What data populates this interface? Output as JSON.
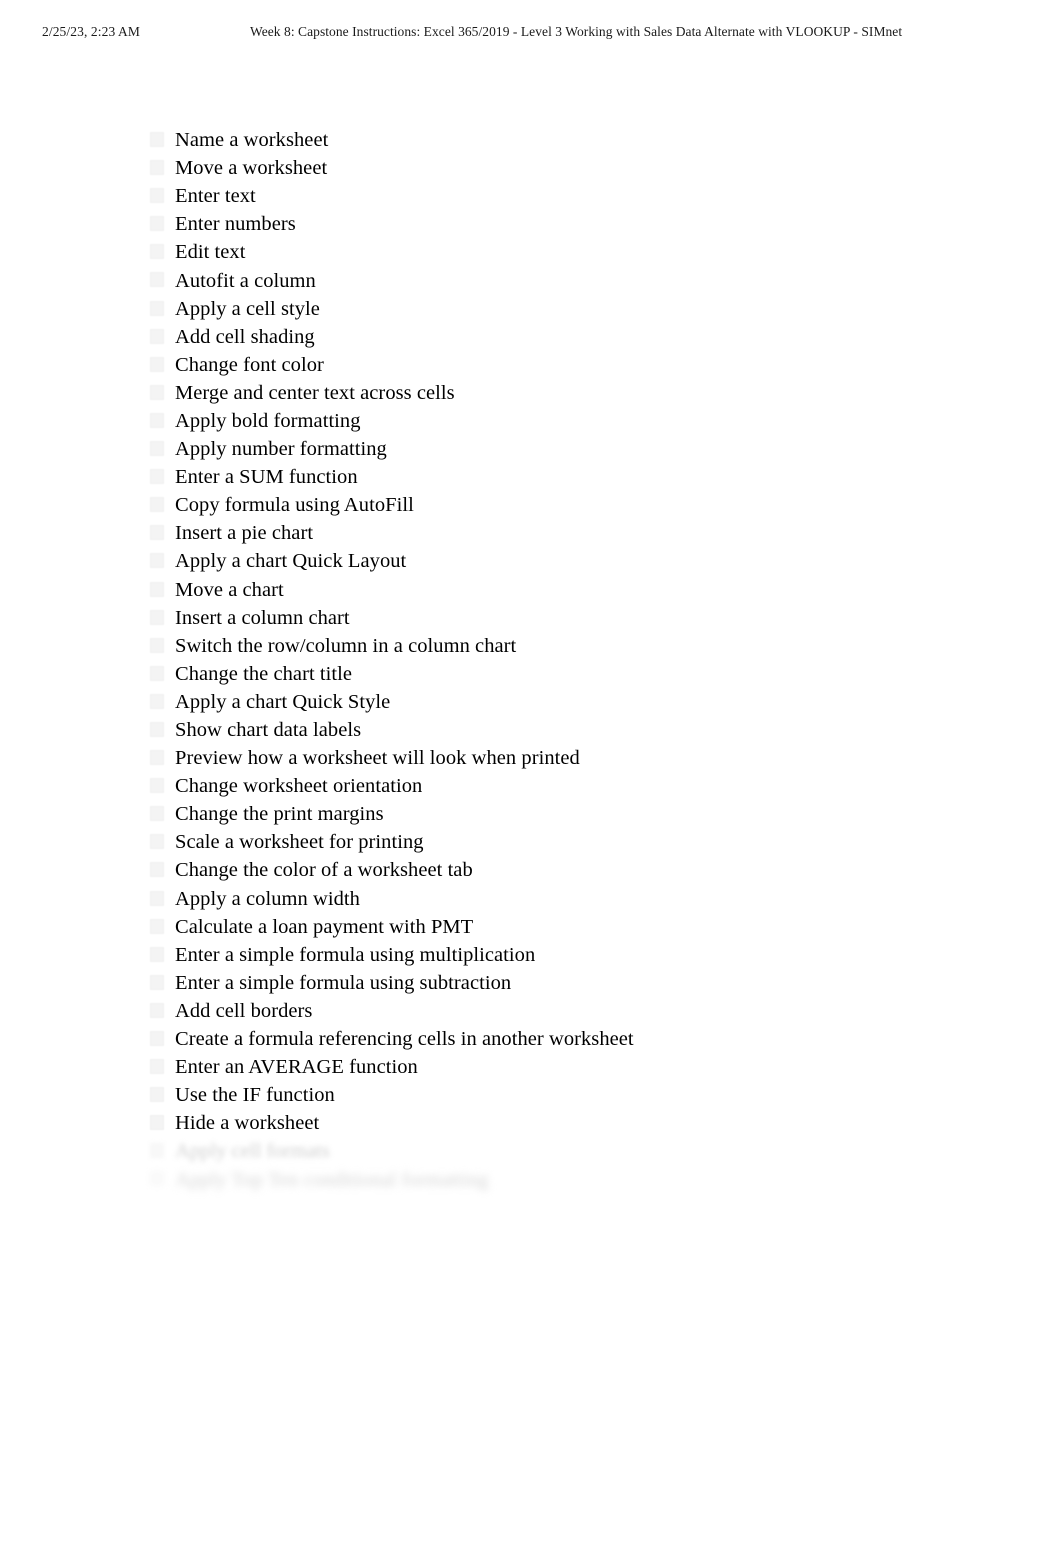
{
  "header": {
    "date": "2/25/23, 2:23 AM",
    "title": "Week 8: Capstone Instructions: Excel 365/2019 - Level 3 Working with Sales Data Alternate with VLOOKUP - SIMnet"
  },
  "skills": {
    "marker_icon": "checkbox-placeholder-icon",
    "items": [
      {
        "label": "Name a worksheet",
        "state": "visible"
      },
      {
        "label": "Move a worksheet",
        "state": "visible"
      },
      {
        "label": "Enter text",
        "state": "visible"
      },
      {
        "label": "Enter numbers",
        "state": "visible"
      },
      {
        "label": "Edit text",
        "state": "visible"
      },
      {
        "label": "Autofit a column",
        "state": "visible"
      },
      {
        "label": "Apply a cell style",
        "state": "visible"
      },
      {
        "label": "Add cell shading",
        "state": "visible"
      },
      {
        "label": "Change font color",
        "state": "visible"
      },
      {
        "label": "Merge and center text across cells",
        "state": "visible"
      },
      {
        "label": "Apply bold formatting",
        "state": "visible"
      },
      {
        "label": "Apply number formatting",
        "state": "visible"
      },
      {
        "label": "Enter a SUM function",
        "state": "visible"
      },
      {
        "label": "Copy formula using AutoFill",
        "state": "visible"
      },
      {
        "label": "Insert a pie chart",
        "state": "visible"
      },
      {
        "label": "Apply a chart Quick Layout",
        "state": "visible"
      },
      {
        "label": "Move a chart",
        "state": "visible"
      },
      {
        "label": "Insert a column chart",
        "state": "visible"
      },
      {
        "label": "Switch the row/column in a column chart",
        "state": "visible"
      },
      {
        "label": "Change the chart title",
        "state": "visible"
      },
      {
        "label": "Apply a chart Quick Style",
        "state": "visible"
      },
      {
        "label": "Show chart data labels",
        "state": "visible"
      },
      {
        "label": "Preview how a worksheet will look when printed",
        "state": "visible"
      },
      {
        "label": "Change worksheet orientation",
        "state": "visible"
      },
      {
        "label": "Change the print margins",
        "state": "visible"
      },
      {
        "label": "Scale a worksheet for printing",
        "state": "visible"
      },
      {
        "label": "Change the color of a worksheet tab",
        "state": "visible"
      },
      {
        "label": "Apply a column width",
        "state": "visible"
      },
      {
        "label": "Calculate a loan payment with PMT",
        "state": "visible"
      },
      {
        "label": "Enter a simple formula using multiplication",
        "state": "visible"
      },
      {
        "label": "Enter a simple formula using subtraction",
        "state": "visible"
      },
      {
        "label": "Add cell borders",
        "state": "visible"
      },
      {
        "label": "Create a formula referencing cells in another worksheet",
        "state": "visible"
      },
      {
        "label": "Enter an AVERAGE function",
        "state": "visible"
      },
      {
        "label": "Use the IF function",
        "state": "visible"
      },
      {
        "label": "Hide a worksheet",
        "state": "visible"
      },
      {
        "label": "Apply cell formats",
        "state": "faded"
      },
      {
        "label": "Apply Top Ten conditional formatting",
        "state": "faded"
      }
    ]
  },
  "colors": {
    "page_background": "#ffffff",
    "text": "#000000",
    "header_text": "#1a1a1a",
    "marker_fill": "#f4f4f4",
    "faded_text": "#cfcfcf"
  }
}
